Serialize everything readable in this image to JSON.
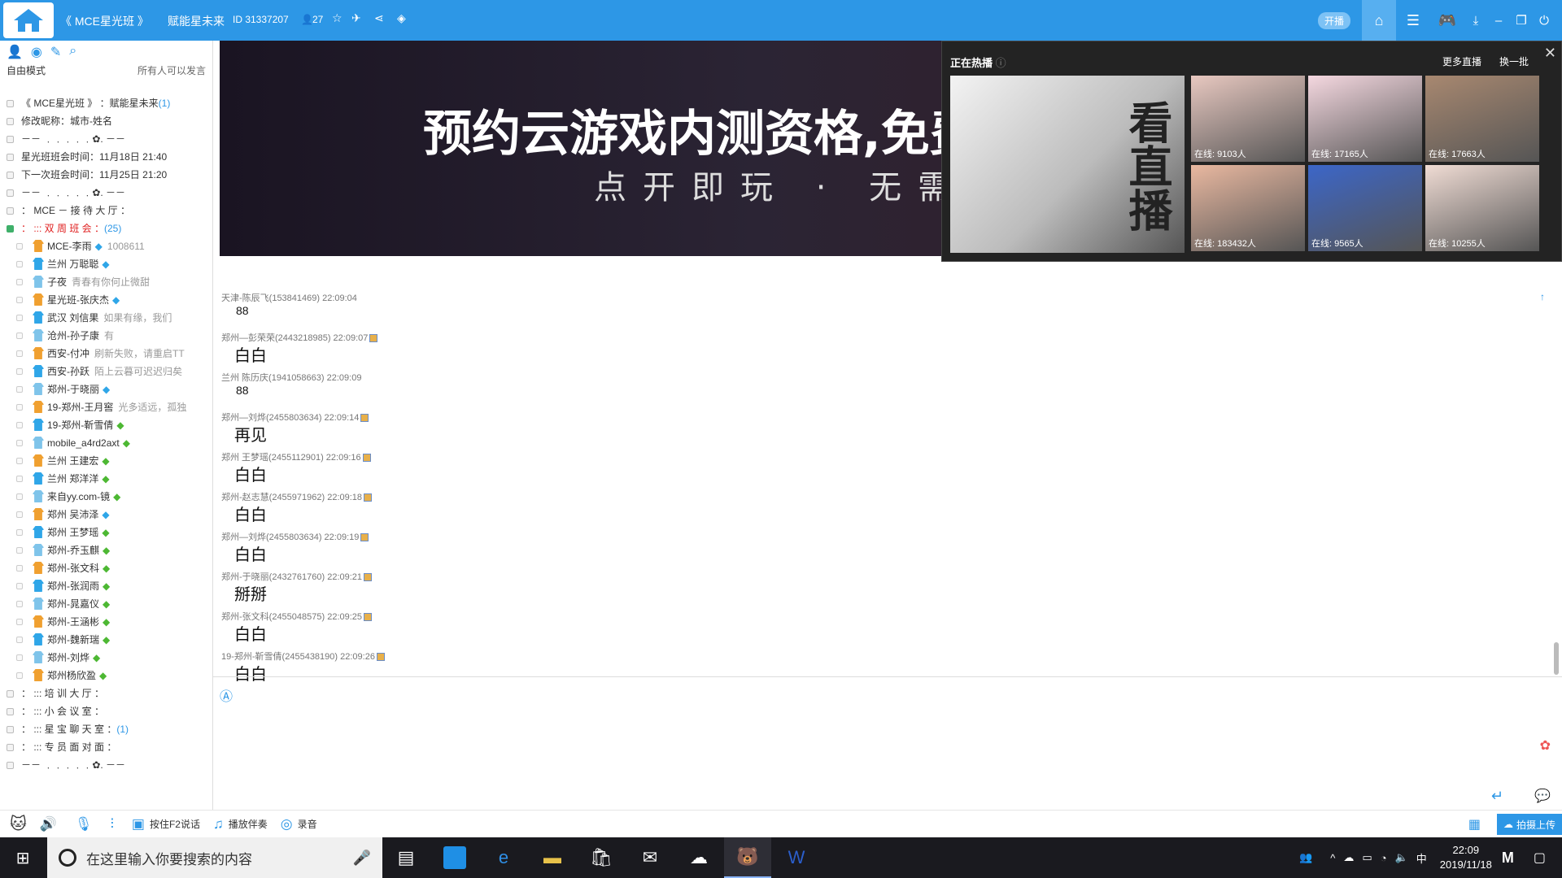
{
  "titlebar": {
    "channel_name": "《 MCE星光班 》",
    "sub_name": "赋能星未来",
    "channel_id": "ID 31337207",
    "online_count": "27",
    "live_toggle": "开播"
  },
  "leftpane": {
    "mode": "自由模式",
    "speak_permission": "所有人可以发言",
    "tree": [
      {
        "type": "channel",
        "label": "《 MCE星光班 》 ：赋能星未来",
        "count": "(1)"
      },
      {
        "type": "channel",
        "label": "修改昵称：城市-姓名"
      },
      {
        "type": "channel",
        "label": "－－ ﹒﹒﹒﹒﹒✿.              －－"
      },
      {
        "type": "channel",
        "label": "星光班班会时间：11月18日 21:40"
      },
      {
        "type": "channel",
        "label": "下一次班会时间：11月25日 21:20"
      },
      {
        "type": "channel",
        "label": "－－ ﹒﹒﹒﹒﹒✿.              －－"
      },
      {
        "type": "channel",
        "label": "：   MCE  － 接 待 大 厅      ："
      },
      {
        "type": "channel_open",
        "label": "：   :::      双 周 班 会      ：",
        "count": "(25)"
      },
      {
        "type": "member",
        "label": "MCE-李雨",
        "sub": "1008611",
        "tag": "gem"
      },
      {
        "type": "member",
        "label": "兰州  万聪聪",
        "tag": "gem"
      },
      {
        "type": "member",
        "label": "子夜",
        "sub": "青春有你何止微甜"
      },
      {
        "type": "member",
        "label": "星光班-张庆杰",
        "tag": "gem"
      },
      {
        "type": "member",
        "label": "武汉  刘信果",
        "sub": "如果有缘，我们"
      },
      {
        "type": "member",
        "label": "沧州-孙子康",
        "sub": "有"
      },
      {
        "type": "member",
        "label": "西安-付冲",
        "sub": "刷新失败，请重启TT"
      },
      {
        "type": "member",
        "label": "西安-孙跃",
        "sub": "陌上云暮可迟迟归矣"
      },
      {
        "type": "member",
        "label": "郑州-于晓丽",
        "tag": "gem"
      },
      {
        "type": "member",
        "label": "19-郑州-王月窖",
        "sub": "光多适远，孤独"
      },
      {
        "type": "member",
        "label": "19-郑州-靳雪倩",
        "tag": "leaf"
      },
      {
        "type": "member",
        "label": "mobile_a4rd2axt",
        "tag": "leaf"
      },
      {
        "type": "member",
        "label": "兰州  王建宏",
        "tag": "leaf"
      },
      {
        "type": "member",
        "label": "兰州  郑洋洋",
        "tag": "leaf"
      },
      {
        "type": "member",
        "label": "来自yy.com-镜",
        "tag": "leaf"
      },
      {
        "type": "member",
        "label": "郑州  吴沛泽",
        "tag": "gem"
      },
      {
        "type": "member",
        "label": "郑州  王梦瑶",
        "tag": "leaf"
      },
      {
        "type": "member",
        "label": "郑州-乔玉麒",
        "tag": "leaf"
      },
      {
        "type": "member",
        "label": "郑州-张文科",
        "tag": "leaf"
      },
      {
        "type": "member",
        "label": "郑州-张润雨",
        "tag": "leaf"
      },
      {
        "type": "member",
        "label": "郑州-晁嘉仪",
        "tag": "leaf"
      },
      {
        "type": "member",
        "label": "郑州-王涵彬",
        "tag": "leaf"
      },
      {
        "type": "member",
        "label": "郑州-魏新瑞",
        "tag": "leaf"
      },
      {
        "type": "member",
        "label": "郑州-刘烨",
        "tag": "leaf"
      },
      {
        "type": "member",
        "label": "郑州杨欣盈",
        "tag": "leaf"
      },
      {
        "type": "channel",
        "label": "：   :::      培 训 大 厅      ："
      },
      {
        "type": "channel",
        "label": "：   :::      小 会 议 室      ："
      },
      {
        "type": "channel",
        "label": "：   :::      星 宝 聊 天 室   ：",
        "count": "(1)"
      },
      {
        "type": "channel",
        "label": "：   :::      专 员 面 对 面   ："
      },
      {
        "type": "channel",
        "label": "－－ ﹒﹒﹒﹒﹒✿.              －－"
      }
    ]
  },
  "banner": {
    "headline": "预约云游戏内测资格,免费",
    "subline": "点开即玩 · 无需"
  },
  "hotlive": {
    "title": "正在热播",
    "more": "更多直播",
    "refresh": "换一批",
    "big_text": "看直播",
    "thumbs": [
      "在线: 9103人",
      "在线: 17165人",
      "在线: 17663人",
      "在线: 183432人",
      "在线: 9565人",
      "在线: 10255人"
    ],
    "colors": [
      "#e8c8c0",
      "#f5d8e0",
      "#a88870",
      "#e9b8a0",
      "#3c66c8",
      "#f0dcd4"
    ]
  },
  "chat": [
    {
      "header": "天津-陈辰飞(153841469) 22:09:04",
      "body": "88",
      "size": "small"
    },
    {
      "header": "郑州—彭荣荣(2443218985) 22:09:07",
      "body": "白白",
      "cam": true
    },
    {
      "header": "兰州 陈历庆(1941058663) 22:09:09",
      "body": "88",
      "size": "small"
    },
    {
      "header": "郑州—刘烨(2455803634) 22:09:14",
      "body": "再见",
      "cam": true
    },
    {
      "header": "郑州 王梦瑶(2455112901) 22:09:16",
      "body": "白白",
      "cam": true
    },
    {
      "header": "郑州-赵志慧(2455971962) 22:09:18",
      "body": "白白",
      "cam": true
    },
    {
      "header": "郑州—刘烨(2455803634) 22:09:19",
      "body": "白白",
      "cam": true
    },
    {
      "header": "郑州-于晓丽(2432761760) 22:09:21",
      "body": "掰掰",
      "cam": true
    },
    {
      "header": "郑州-张文科(2455048575) 22:09:25",
      "body": "白白",
      "cam": true
    },
    {
      "header": "19-郑州-靳雪倩(2455438190) 22:09:26",
      "body": "白白",
      "cam": true
    }
  ],
  "bottombar": {
    "f2_talk": "按住F2说话",
    "play_music": "播放伴奏",
    "record": "录音",
    "upload": "拍摄上传"
  },
  "taskbar": {
    "search_placeholder": "在这里输入你要搜索的内容",
    "time": "22:09",
    "date": "2019/11/18",
    "ime": "中"
  }
}
